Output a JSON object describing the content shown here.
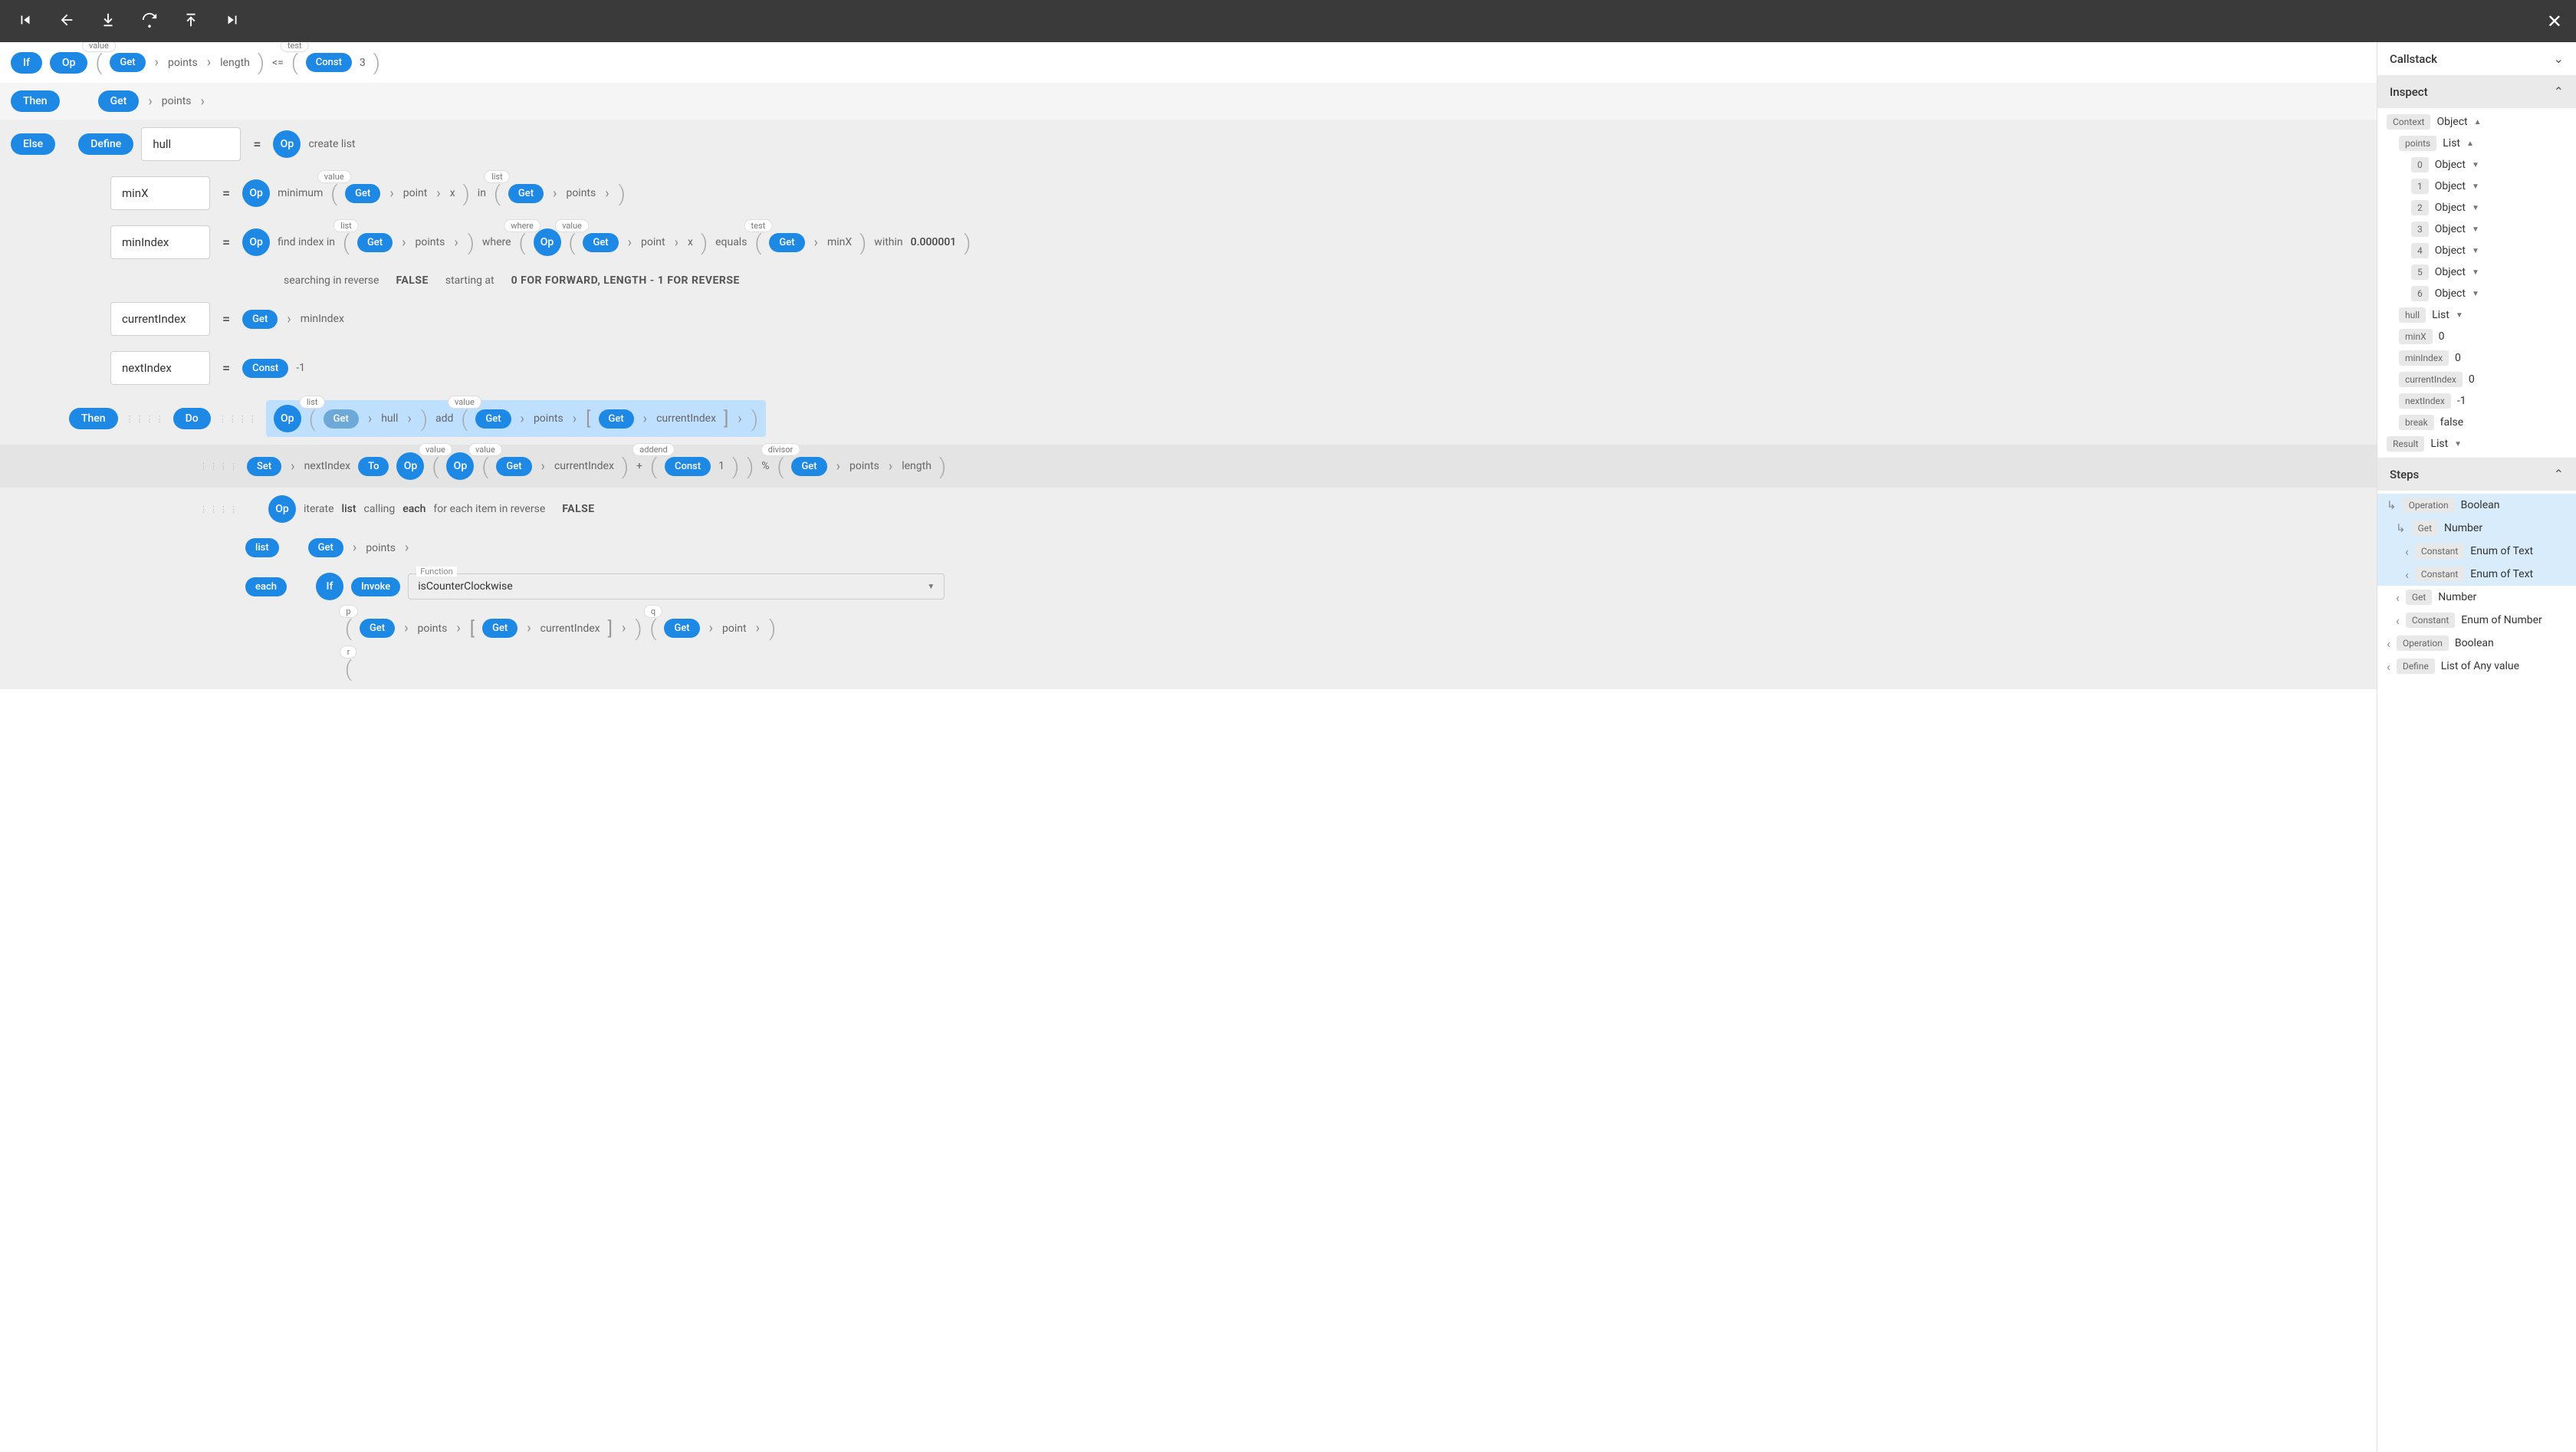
{
  "buttons": {
    "if": "If",
    "op": "Op",
    "then": "Then",
    "get": "Get",
    "else": "Else",
    "define": "Define",
    "const": "Const",
    "do": "Do",
    "set": "Set",
    "to": "To",
    "list": "list",
    "each": "each",
    "invoke": "Invoke"
  },
  "labels": {
    "value": "value",
    "test": "test",
    "list": "list",
    "where": "where",
    "addend": "addend",
    "divisor": "divisor",
    "p": "p",
    "q": "q",
    "r": "r",
    "function": "Function"
  },
  "text": {
    "points": "points",
    "length": "length",
    "lessEq": "<=",
    "three": "3",
    "hull": "hull",
    "createList": "create list",
    "minX": "minX",
    "minimum": "minimum",
    "point": "point",
    "x": "x",
    "in": "in",
    "minIndex": "minIndex",
    "findIndex": "find index in",
    "whereWord": "where",
    "equals": "equals",
    "within": "within",
    "tolerance": "0.000001",
    "searchRev": "searching in reverse",
    "falseVal": "FALSE",
    "startAt": "starting at",
    "startDefault": "0 FOR FORWARD, LENGTH - 1 FOR REVERSE",
    "currentIndex": "currentIndex",
    "nextIndex": "nextIndex",
    "negOne": "-1",
    "add": "add",
    "plus": "+",
    "pct": "%",
    "one": "1",
    "iterate": "iterate",
    "calling": "calling",
    "eachWord": "each",
    "forEachRev": "for each item in reverse",
    "isCCW": "isCounterClockwise"
  },
  "right": {
    "callstack": "Callstack",
    "inspect": "Inspect",
    "steps": "Steps",
    "context": "Context",
    "object": "Object",
    "listType": "List",
    "pointsKey": "points",
    "indices": [
      "0",
      "1",
      "2",
      "3",
      "4",
      "5",
      "6"
    ],
    "vars": [
      {
        "k": "hull",
        "t": "List",
        "arrow": "down"
      },
      {
        "k": "minX",
        "t": "0"
      },
      {
        "k": "minIndex",
        "t": "0"
      },
      {
        "k": "currentIndex",
        "t": "0"
      },
      {
        "k": "nextIndex",
        "t": "-1"
      },
      {
        "k": "break",
        "t": "false"
      }
    ],
    "result": "Result",
    "stepItems": [
      {
        "icon": "rarr",
        "label": "Operation",
        "type": "Boolean",
        "hl": true
      },
      {
        "icon": "rarr",
        "label": "Get",
        "type": "Number",
        "hl": true,
        "indent": 1
      },
      {
        "icon": "left",
        "label": "Constant",
        "type": "Enum of Text",
        "hl": true,
        "indent": 2
      },
      {
        "icon": "left",
        "label": "Constant",
        "type": "Enum of Text",
        "hl": true,
        "indent": 2
      },
      {
        "icon": "left",
        "label": "Get",
        "type": "Number",
        "indent": 1
      },
      {
        "icon": "left",
        "label": "Constant",
        "type": "Enum of Number",
        "indent": 1
      },
      {
        "icon": "left",
        "label": "Operation",
        "type": "Boolean"
      },
      {
        "icon": "left",
        "label": "Define",
        "type": "List of Any value"
      }
    ]
  }
}
